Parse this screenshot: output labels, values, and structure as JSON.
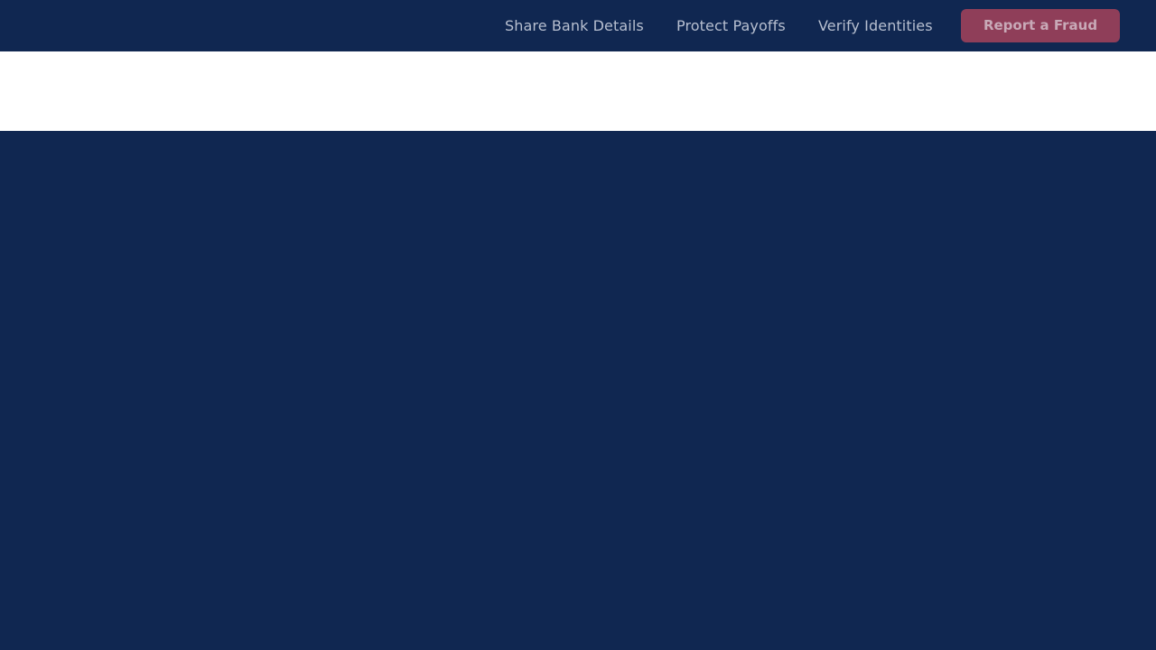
{
  "nav": {
    "links": [
      {
        "label": "Share Bank Details"
      },
      {
        "label": "Protect Payoffs"
      },
      {
        "label": "Verify Identities"
      }
    ],
    "cta_label": "Report a Fraud"
  },
  "colors": {
    "background": "#102751",
    "band": "#ffffff",
    "cta_background": "#8f3e59",
    "nav_text": "#b7bfd0"
  }
}
